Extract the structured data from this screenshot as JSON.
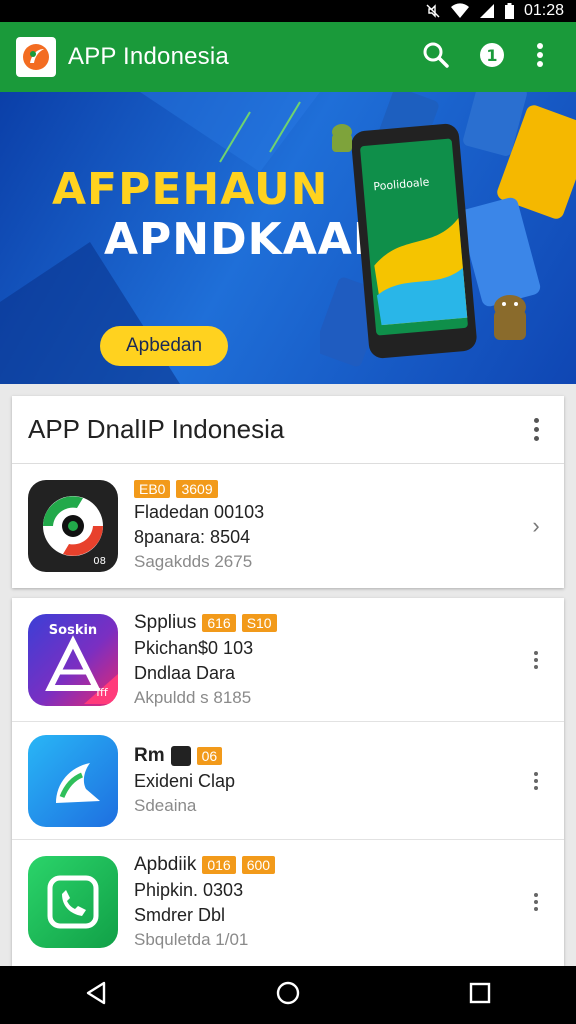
{
  "status_bar": {
    "time": "01:28",
    "icons": [
      "mute-icon",
      "wifi-icon",
      "signal-icon",
      "battery-icon"
    ]
  },
  "app_bar": {
    "title": "APP Indonesia",
    "actions": [
      "search-icon",
      "notification-icon",
      "more-vert-icon"
    ],
    "color": "#1a9a3a"
  },
  "banner": {
    "headline_1": "AFPEHAUN",
    "headline_2": "APNDKAAL",
    "button_label": "Apbedan",
    "phone_text": "Poolidoale"
  },
  "featured": {
    "title": "APP DnalIP Indonesia",
    "apps": [
      {
        "badges": [
          "EB0",
          "3609"
        ],
        "line1_label": "",
        "name": "Fladedan 00103",
        "sub": "8panara: 8504",
        "meta": "Sagakdds 2675"
      }
    ]
  },
  "app_list": [
    {
      "label": "Spplius",
      "badges": [
        "616",
        "S10"
      ],
      "name": "Pkichan$0 103",
      "sub": "Dndlaa Dara",
      "meta": "Akpuldd s 8185",
      "icon_text": "Soskin",
      "icon_corner": "fff"
    },
    {
      "label": "Rm",
      "badges": [
        "",
        "06"
      ],
      "name": "Exideni Clap",
      "sub": "",
      "meta": "Sdeaina"
    },
    {
      "label": "Apbdiik",
      "badges": [
        "016",
        "600"
      ],
      "name": "Phipkin. 0303",
      "sub": "Smdrer Dbl",
      "meta": "Sbquletda 1/01"
    }
  ],
  "nav": [
    "back-icon",
    "home-icon",
    "recents-icon"
  ],
  "colors": {
    "accent_green": "#1a9a3a",
    "badge_orange": "#f29a1a",
    "banner_yellow": "#ffd21f"
  }
}
